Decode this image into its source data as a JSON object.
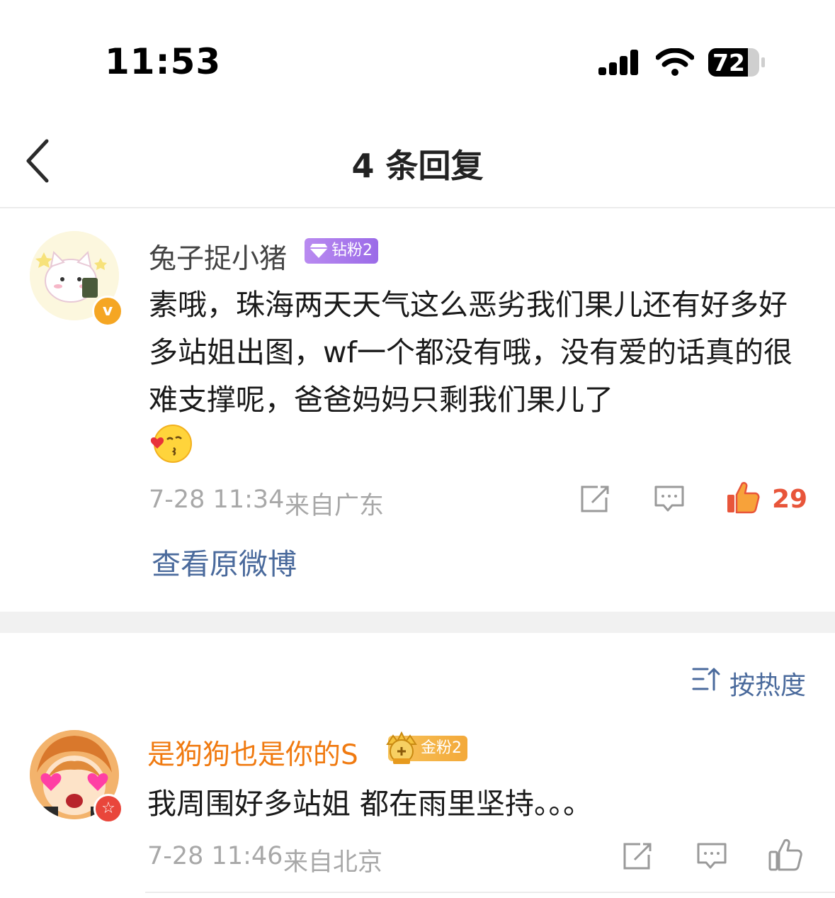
{
  "status_bar": {
    "time": "11:53",
    "battery": "72",
    "icons": [
      "cellular-signal-icon",
      "wifi-icon",
      "battery-icon"
    ]
  },
  "nav": {
    "title": "4 条回复",
    "back_icon": "chevron-left-icon"
  },
  "main_comment": {
    "username": "兔子捉小猪",
    "fan_badge": "钻粉2",
    "text": "素哦，珠海两天天气这么恶劣我们果儿还有好多好多站姐出图，wf一个都没有哦，没有爱的话真的很难支撑呢，爸爸妈妈只剩我们果儿了",
    "emoji": "kissing-face-emoji",
    "time": "7-28 11:34",
    "location": "来自广东",
    "like_count": "29",
    "view_original": "查看原微博",
    "verified_icon": "v"
  },
  "sort": {
    "label": "按热度",
    "icon": "sort-icon"
  },
  "reply": {
    "username": "是狗狗也是你的S",
    "fan_badge": "金粉2",
    "text": "我周围好多站姐 都在雨里坚持。。。",
    "time": "7-28 11:46",
    "location": "来自北京",
    "vip_icon": "☆"
  },
  "colors": {
    "link_blue": "#4a6a9c",
    "like_orange": "#e8553a",
    "username_orange": "#f07a10",
    "diamond_badge": "#a47bec",
    "gold_badge": "#f5b849"
  }
}
